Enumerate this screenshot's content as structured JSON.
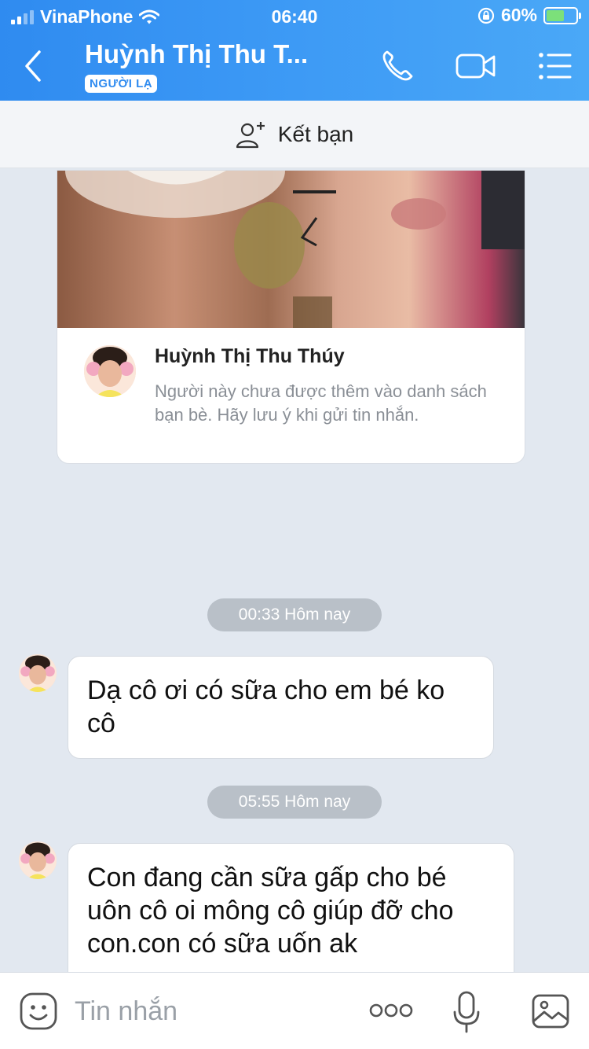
{
  "status_bar": {
    "carrier": "VinaPhone",
    "time": "06:40",
    "battery": "60%",
    "battery_level": 0.6
  },
  "header": {
    "title": "Huỳnh Thị Thu T...",
    "badge": "NGƯỜI LẠ"
  },
  "add_friend": {
    "label": "Kết bạn"
  },
  "profile_card": {
    "name": "Huỳnh Thị Thu Thúy",
    "notice": "Người này chưa được thêm vào danh sách bạn bè. Hãy lưu ý khi gửi tin nhắn."
  },
  "messages": [
    {
      "timestamp": "00:33 Hôm nay",
      "text": "Dạ cô ơi có sữa cho em bé ko cô"
    },
    {
      "timestamp": "05:55 Hôm nay",
      "text": "Con đang cần sữa gấp cho bé uôn cô oi mông cô giúp đỡ cho con.con có sữa uốn ak"
    }
  ],
  "composer": {
    "placeholder": "Tin nhắn"
  },
  "colors": {
    "header_start": "#2f8bf0",
    "header_end": "#4aa8f7",
    "background": "#e2e8f0",
    "pill": "#b9c0c8"
  },
  "icons": [
    "signal-icon",
    "wifi-icon",
    "lock-rotation-icon",
    "battery-icon",
    "back-icon",
    "phone-icon",
    "video-icon",
    "menu-icon",
    "add-friend-icon",
    "emoji-icon",
    "more-icon",
    "microphone-icon",
    "image-icon"
  ]
}
